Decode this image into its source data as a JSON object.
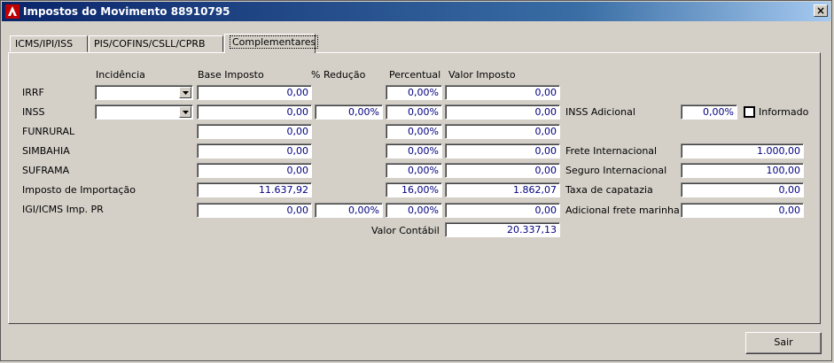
{
  "window": {
    "title": "Impostos do Movimento 88910795",
    "close_glyph": "×"
  },
  "tabs": [
    {
      "label": "ICMS/IPI/ISS"
    },
    {
      "label": "PIS/COFINS/CSLL/CPRB"
    },
    {
      "label": "Complementares"
    }
  ],
  "headers": {
    "incidencia": "Incidência",
    "base": "Base Imposto",
    "reducao": "% Redução",
    "percentual": "Percentual",
    "valor": "Valor Imposto"
  },
  "rows": [
    {
      "label": "IRRF",
      "incidencia": "",
      "base": "0,00",
      "reducao": null,
      "percentual": "0,00%",
      "valor": "0,00"
    },
    {
      "label": "INSS",
      "incidencia": "",
      "base": "0,00",
      "reducao": "0,00%",
      "percentual": "0,00%",
      "valor": "0,00"
    },
    {
      "label": "FUNRURAL",
      "base": "0,00",
      "percentual": "0,00%",
      "valor": "0,00"
    },
    {
      "label": "SIMBAHIA",
      "base": "0,00",
      "percentual": "0,00%",
      "valor": "0,00"
    },
    {
      "label": "SUFRAMA",
      "base": "0,00",
      "percentual": "0,00%",
      "valor": "0,00"
    },
    {
      "label": "Imposto de Importação",
      "base": "11.637,92",
      "percentual": "16,00%",
      "valor": "1.862,07"
    },
    {
      "label": "IGI/ICMS Imp. PR",
      "base": "0,00",
      "reducao": "0,00%",
      "percentual": "0,00%",
      "valor": "0,00"
    }
  ],
  "valor_contabil": {
    "label": "Valor Contábil",
    "value": "20.337,13"
  },
  "right": {
    "inss_adicional": {
      "label": "INSS Adicional",
      "value": "0,00%",
      "informado_label": "Informado",
      "informado_checked": false
    },
    "frete_internacional": {
      "label": "Frete Internacional",
      "value": "1.000,00"
    },
    "seguro_internacional": {
      "label": "Seguro Internacional",
      "value": "100,00"
    },
    "taxa_capatazia": {
      "label": "Taxa de capatazia",
      "value": "0,00"
    },
    "adicional_frete_marinha": {
      "label": "Adicional frete marinha",
      "value": "0,00"
    }
  },
  "buttons": {
    "exit_label": "Sair"
  }
}
